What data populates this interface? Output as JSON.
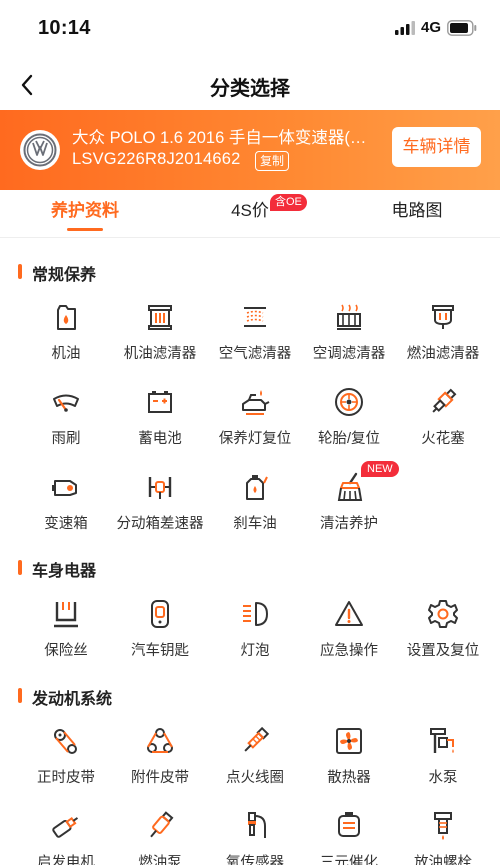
{
  "status_bar": {
    "time": "10:14",
    "network": "4G"
  },
  "nav": {
    "title": "分类选择"
  },
  "vehicle": {
    "name": "大众 POLO 1.6 2016 手自一体变速器(…",
    "vin": "LSVG226R8J2014662",
    "copy_label": "复制",
    "detail_label": "车辆详情"
  },
  "tabs": [
    {
      "label": "养护资料",
      "active": true
    },
    {
      "label": "4S价",
      "badge": "含OE"
    },
    {
      "label": "电路图"
    }
  ],
  "sections": {
    "maintenance": {
      "title": "常规保养",
      "items": [
        {
          "label": "机油",
          "icon": "engine-oil-icon"
        },
        {
          "label": "机油滤清器",
          "icon": "oil-filter-icon"
        },
        {
          "label": "空气滤清器",
          "icon": "air-filter-icon"
        },
        {
          "label": "空调滤清器",
          "icon": "ac-filter-icon"
        },
        {
          "label": "燃油滤清器",
          "icon": "fuel-filter-icon"
        },
        {
          "label": "雨刷",
          "icon": "wiper-icon"
        },
        {
          "label": "蓄电池",
          "icon": "battery-icon"
        },
        {
          "label": "保养灯复位",
          "icon": "service-light-icon"
        },
        {
          "label": "轮胎/复位",
          "icon": "tire-icon"
        },
        {
          "label": "火花塞",
          "icon": "spark-plug-icon"
        },
        {
          "label": "变速箱",
          "icon": "gearbox-icon"
        },
        {
          "label": "分动箱差速器",
          "icon": "differential-icon"
        },
        {
          "label": "刹车油",
          "icon": "brake-fluid-icon"
        },
        {
          "label": "清洁养护",
          "icon": "cleaning-brush-icon",
          "badge": "NEW"
        }
      ]
    },
    "electrical": {
      "title": "车身电器",
      "items": [
        {
          "label": "保险丝",
          "icon": "fuse-icon"
        },
        {
          "label": "汽车钥匙",
          "icon": "car-key-icon"
        },
        {
          "label": "灯泡",
          "icon": "headlight-icon"
        },
        {
          "label": "应急操作",
          "icon": "warning-icon"
        },
        {
          "label": "设置及复位",
          "icon": "settings-gear-icon"
        }
      ]
    },
    "engine": {
      "title": "发动机系统",
      "items": [
        {
          "label": "正时皮带",
          "icon": "timing-belt-icon"
        },
        {
          "label": "附件皮带",
          "icon": "accessory-belt-icon"
        },
        {
          "label": "点火线圈",
          "icon": "ignition-coil-icon"
        },
        {
          "label": "散热器",
          "icon": "radiator-fan-icon"
        },
        {
          "label": "水泵",
          "icon": "water-pump-icon"
        },
        {
          "label": "启发电机",
          "icon": "starter-motor-icon"
        },
        {
          "label": "燃油泵",
          "icon": "fuel-pump-icon"
        },
        {
          "label": "氧传感器",
          "icon": "oxygen-sensor-icon"
        },
        {
          "label": "三元催化",
          "icon": "catalytic-converter-icon"
        },
        {
          "label": "放油螺栓",
          "icon": "drain-plug-icon"
        }
      ]
    }
  },
  "colors": {
    "accent": "#ff6a1f",
    "icon_dark": "#333333",
    "badge_red": "#f32d3a"
  }
}
